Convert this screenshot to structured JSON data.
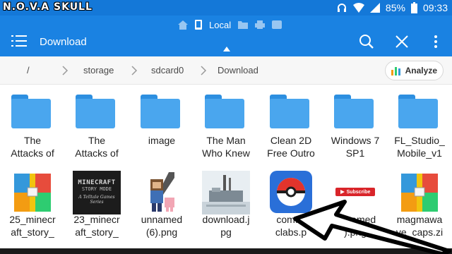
{
  "status": {
    "watermark": "N.O.V.A SKULL",
    "battery": "85%",
    "time": "09:33"
  },
  "toolbar": {
    "tab_label": "Local",
    "title": "Download"
  },
  "breadcrumb": {
    "items": [
      "/",
      "storage",
      "sdcard0",
      "Download"
    ],
    "analyze_label": "Analyze"
  },
  "files": [
    {
      "line1": "The",
      "line2": "Attacks of",
      "kind": "folder"
    },
    {
      "line1": "The",
      "line2": "Attacks of",
      "kind": "folder"
    },
    {
      "line1": "image",
      "line2": "",
      "kind": "folder"
    },
    {
      "line1": "The Man",
      "line2": "Who Knew",
      "kind": "folder"
    },
    {
      "line1": "Clean 2D",
      "line2": "Free Outro",
      "kind": "folder"
    },
    {
      "line1": "Windows 7",
      "line2": "SP1",
      "kind": "folder"
    },
    {
      "line1": "FL_Studio_",
      "line2": "Mobile_v1",
      "kind": "folder"
    },
    {
      "line1": "25_minecr",
      "line2": "aft_story_",
      "kind": "archive"
    },
    {
      "line1": "23_minecr",
      "line2": "aft_story_",
      "kind": "minecraft-thumb",
      "thumb_title": "MINECRAFT",
      "thumb_sub": "STORY MODE",
      "thumb_caption": "A Telltale Games Series"
    },
    {
      "line1": "unnamed",
      "line2": "(6).png",
      "kind": "character-thumb"
    },
    {
      "line1": "download.j",
      "line2": "pg",
      "kind": "factory-thumb"
    },
    {
      "line1": "com.ni",
      "line2": "clabs.p",
      "kind": "pokeball-thumb"
    },
    {
      "line1": "unnamed",
      "line2": ").png",
      "kind": "subscribe-thumb",
      "thumb_text": "Subscribe"
    },
    {
      "line1": "magmawa",
      "line2": "ve_caps.zi",
      "kind": "archive"
    }
  ],
  "colors": {
    "statusbar": "#1478d8",
    "toolbar": "#1a82e2",
    "folder": "#4aa6ee",
    "arrow_fill": "#ffffff",
    "arrow_stroke": "#000000"
  },
  "icons": [
    "hamburger-icon",
    "home-icon",
    "search-icon",
    "close-icon",
    "more-vert-icon",
    "chevron-right-icon",
    "bar-chart-icon",
    "headphones-icon",
    "wifi-icon",
    "signal-icon",
    "battery-icon"
  ]
}
